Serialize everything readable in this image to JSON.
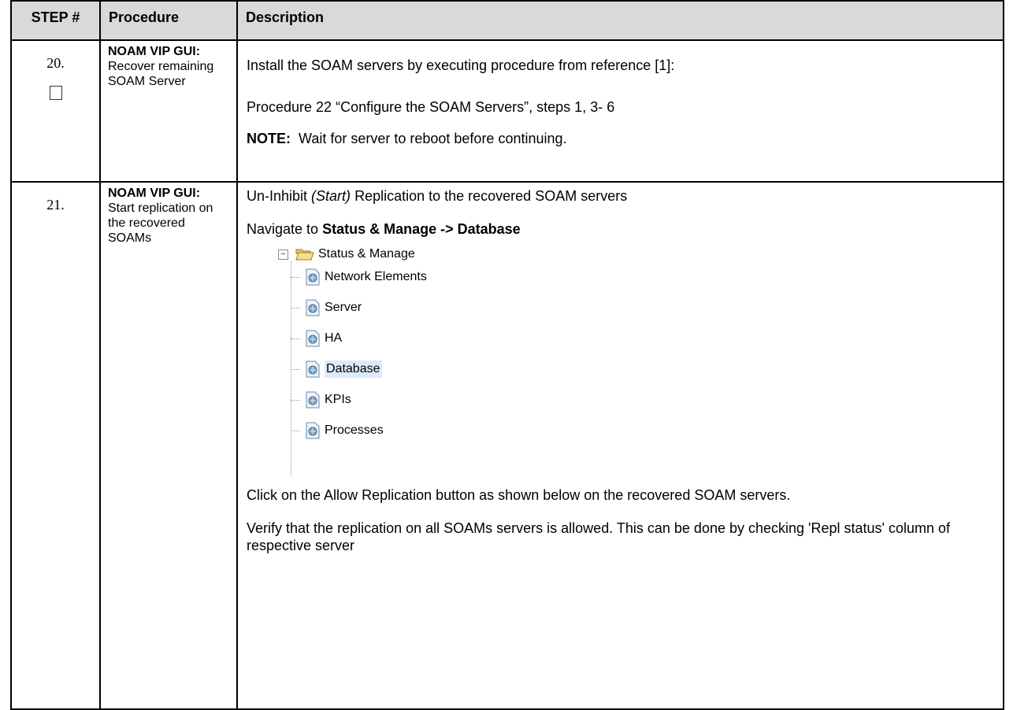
{
  "header": {
    "step": "STEP #",
    "procedure": "Procedure",
    "description": "Description"
  },
  "step20": {
    "number": "20.",
    "proc_bold": "NOAM VIP GUI:",
    "proc_text": "Recover remaining SOAM Server",
    "line1": "Install the SOAM servers by executing procedure from reference  [1]:",
    "line2": "Procedure 22 “Configure the SOAM Servers”, steps 1, 3- 6",
    "note_label": "NOTE:",
    "note_text": "  Wait for server to reboot before continuing."
  },
  "step21": {
    "number": "21.",
    "proc_bold": "NOAM VIP GUI:",
    "proc_text": " Start replication on the recovered SOAMs",
    "line1_pre": "Un-Inhibit ",
    "line1_em": "(Start)",
    "line1_post": " Replication to the recovered SOAM servers",
    "nav_pre": "Navigate to ",
    "nav_path": "Status & Manage -> Database",
    "tree": {
      "root": "Status & Manage",
      "items": [
        "Network Elements",
        "Server",
        "HA",
        "Database",
        "KPIs",
        "Processes"
      ],
      "selected": "Database"
    },
    "line3": "Click on the Allow Replication button as shown below on the recovered SOAM servers.",
    "line4": "Verify that the replication on all SOAMs servers is allowed. This can be done by checking 'Repl status' column of respective server"
  },
  "colors": {
    "header_bg": "#d9d9d9",
    "selection_bg": "#dde9fb"
  }
}
